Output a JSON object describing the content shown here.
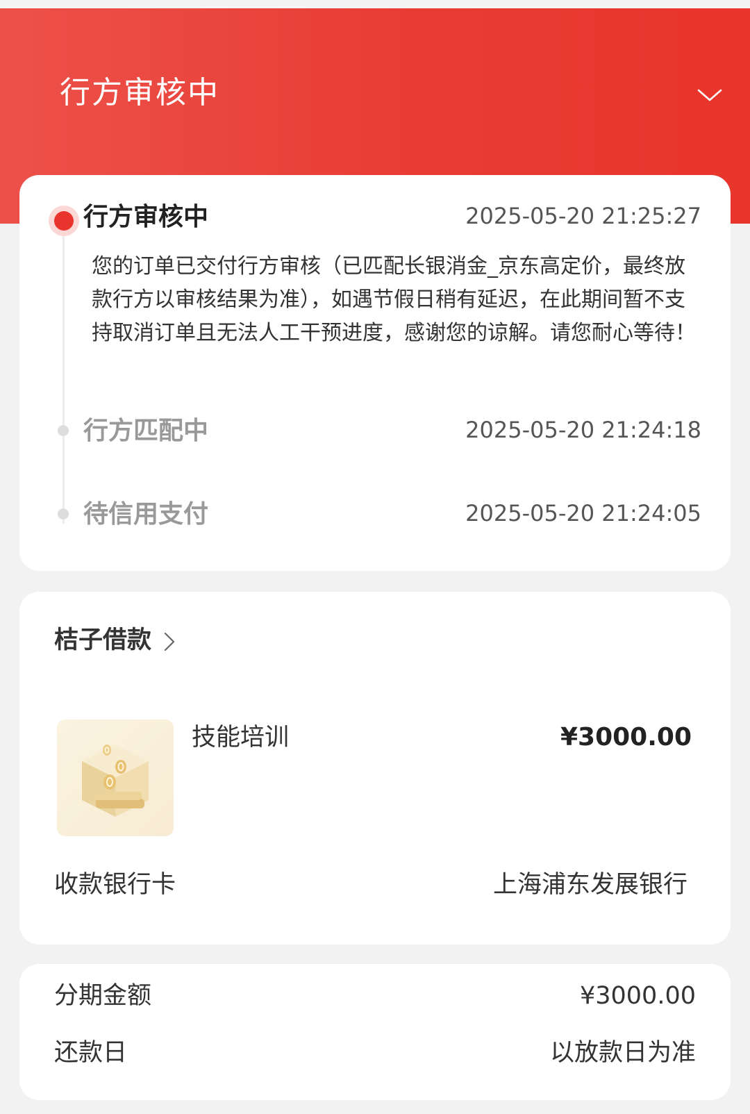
{
  "header": {
    "title": "行方审核中"
  },
  "timeline": [
    {
      "title": "行方审核中",
      "time": "2025-05-20 21:25:27",
      "active": true,
      "description": "您的订单已交付行方审核（已匹配长银消金_京东高定价，最终放款行方以审核结果为准），如遇节假日稍有延迟，在此期间暂不支持取消订单且无法人工干预进度，感谢您的谅解。请您耐心等待！"
    },
    {
      "title": "行方匹配中",
      "time": "2025-05-20 21:24:18",
      "active": false
    },
    {
      "title": "待信用支付",
      "time": "2025-05-20 21:24:05",
      "active": false
    }
  ],
  "product": {
    "brand": "桔子借款",
    "name": "技能培训",
    "price": "¥3000.00",
    "bank_label": "收款银行卡",
    "bank_value": "上海浦东发展银行"
  },
  "plan": {
    "amount_label": "分期金额",
    "amount_value": "¥3000.00",
    "repay_label": "还款日",
    "repay_value": "以放款日为准"
  },
  "colors": {
    "accent": "#e8342d"
  }
}
